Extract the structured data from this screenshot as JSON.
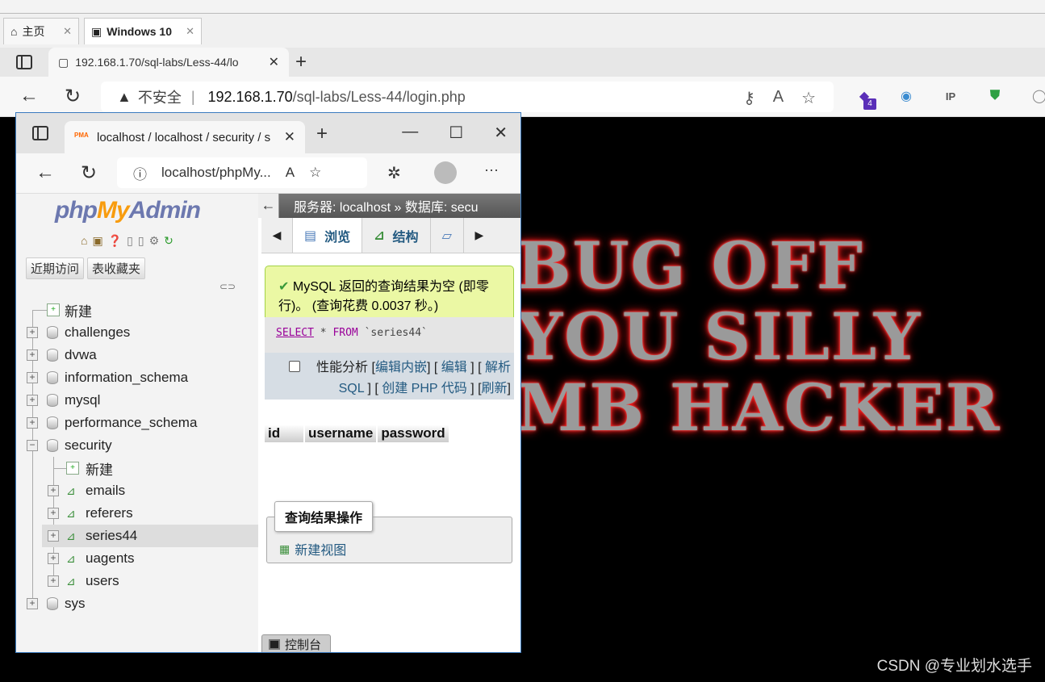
{
  "vm_tabs": [
    {
      "label": "主页",
      "close": "✕"
    },
    {
      "label": "Windows 10",
      "close": "✕"
    }
  ],
  "outer_browser": {
    "tab_title": "192.168.1.70/sql-labs/Less-44/lo",
    "tab_close": "✕",
    "new_tab": "+",
    "insecure_label": "不安全",
    "separator": "|",
    "url_host": "192.168.1.70",
    "url_path": "/sql-labs/Less-44/login.php",
    "extension_badge": "4"
  },
  "background_page": {
    "line1": "BUG OFF",
    "line2": "YOU SILLY",
    "line3": "MB HACKER"
  },
  "watermark": "CSDN @专业划水选手",
  "inner_browser": {
    "tab_title": "localhost / localhost / security / s",
    "tab_close": "✕",
    "new_tab": "+",
    "url": "localhost/phpMy...",
    "more": "···"
  },
  "pma": {
    "logo": {
      "php": "php",
      "my": "My",
      "admin": "Admin"
    },
    "nav_buttons": [
      "近期访问",
      "表收藏夹"
    ],
    "tree": [
      {
        "label": "新建",
        "type": "new",
        "level": 0
      },
      {
        "label": "challenges",
        "type": "db",
        "level": 0
      },
      {
        "label": "dvwa",
        "type": "db",
        "level": 0
      },
      {
        "label": "information_schema",
        "type": "db",
        "level": 0
      },
      {
        "label": "mysql",
        "type": "db",
        "level": 0
      },
      {
        "label": "performance_schema",
        "type": "db",
        "level": 0
      },
      {
        "label": "security",
        "type": "db",
        "level": 0,
        "expanded": true
      },
      {
        "label": "新建",
        "type": "new",
        "level": 1
      },
      {
        "label": "emails",
        "type": "table",
        "level": 1
      },
      {
        "label": "referers",
        "type": "table",
        "level": 1
      },
      {
        "label": "series44",
        "type": "table",
        "level": 1,
        "selected": true
      },
      {
        "label": "uagents",
        "type": "table",
        "level": 1
      },
      {
        "label": "users",
        "type": "table",
        "level": 1
      },
      {
        "label": "sys",
        "type": "db",
        "level": 0
      }
    ],
    "breadcrumb": "服务器: localhost » 数据库: secu",
    "tabs": [
      {
        "label": "浏览",
        "active": true
      },
      {
        "label": "结构",
        "active": false
      }
    ],
    "message": "MySQL 返回的查询结果为空 (即零行)。 (查询花费 0.0037 秒。)",
    "sql": {
      "select": "SELECT",
      "rest1": " * ",
      "from": "FROM",
      "rest2": " `series44`"
    },
    "profiling": {
      "label": "性能分析",
      "edit_inline": "编辑内嵌",
      "edit": "编辑",
      "explain": "解析 SQL",
      "create_php": "创建 PHP 代码",
      "refresh": "刷新"
    },
    "columns": [
      "id",
      "username",
      "password"
    ],
    "result_ops_legend": "查询结果操作",
    "create_view": "新建视图",
    "console": "控制台"
  }
}
